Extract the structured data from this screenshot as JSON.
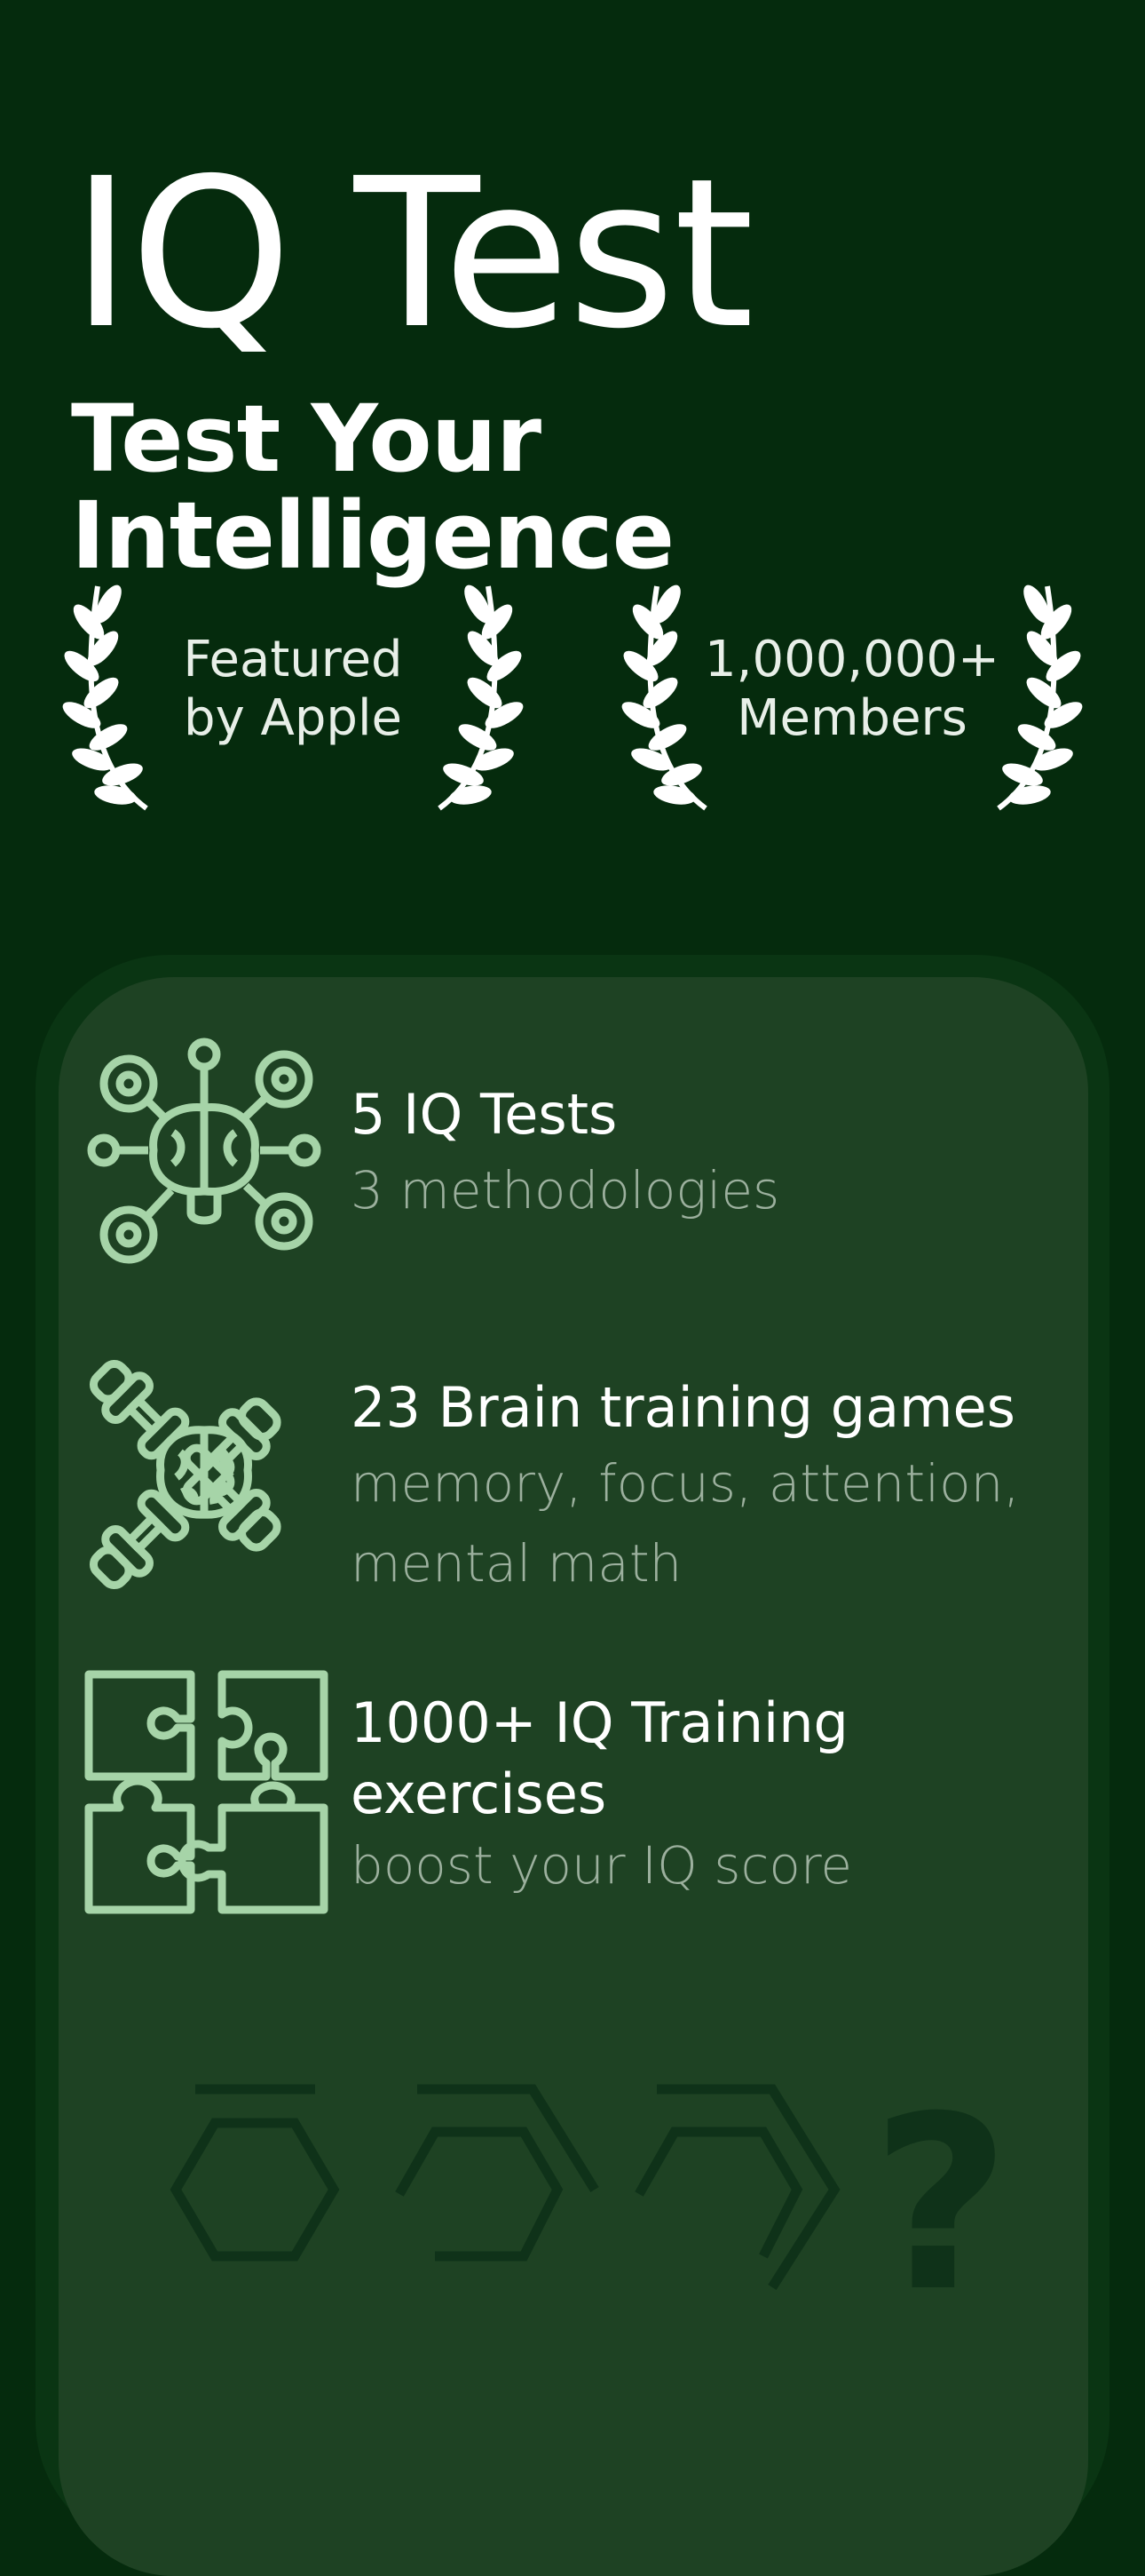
{
  "header": {
    "title": "IQ Test",
    "subtitle": "Test Your Intelligence"
  },
  "awards": [
    {
      "line1": "Featured",
      "line2": "by Apple",
      "icon": "laurel-wreath-icon"
    },
    {
      "line1": "1,000,000+",
      "line2": "Members",
      "icon": "laurel-wreath-icon"
    }
  ],
  "features": [
    {
      "title": "5 IQ Tests",
      "desc_lines": [
        "3 methodologies"
      ],
      "icon": "brain-network-icon"
    },
    {
      "title": "23 Brain training games",
      "desc_lines": [
        "memory, focus, attention,",
        "mental math"
      ],
      "icon": "brain-dumbbells-icon"
    },
    {
      "title_lines": [
        "1000+ IQ Training",
        "exercises"
      ],
      "desc_lines": [
        "boost your IQ score"
      ],
      "icon": "puzzle-pieces-icon"
    }
  ],
  "puzzle": {
    "question_mark": "?"
  },
  "colors": {
    "background": "#052b0d",
    "card": "#1e4223",
    "card_border": "#0a3513",
    "icon_stroke": "#a6d4a8",
    "muted_text": "#9cb09e",
    "puzzle_shape": "#0f3219"
  }
}
